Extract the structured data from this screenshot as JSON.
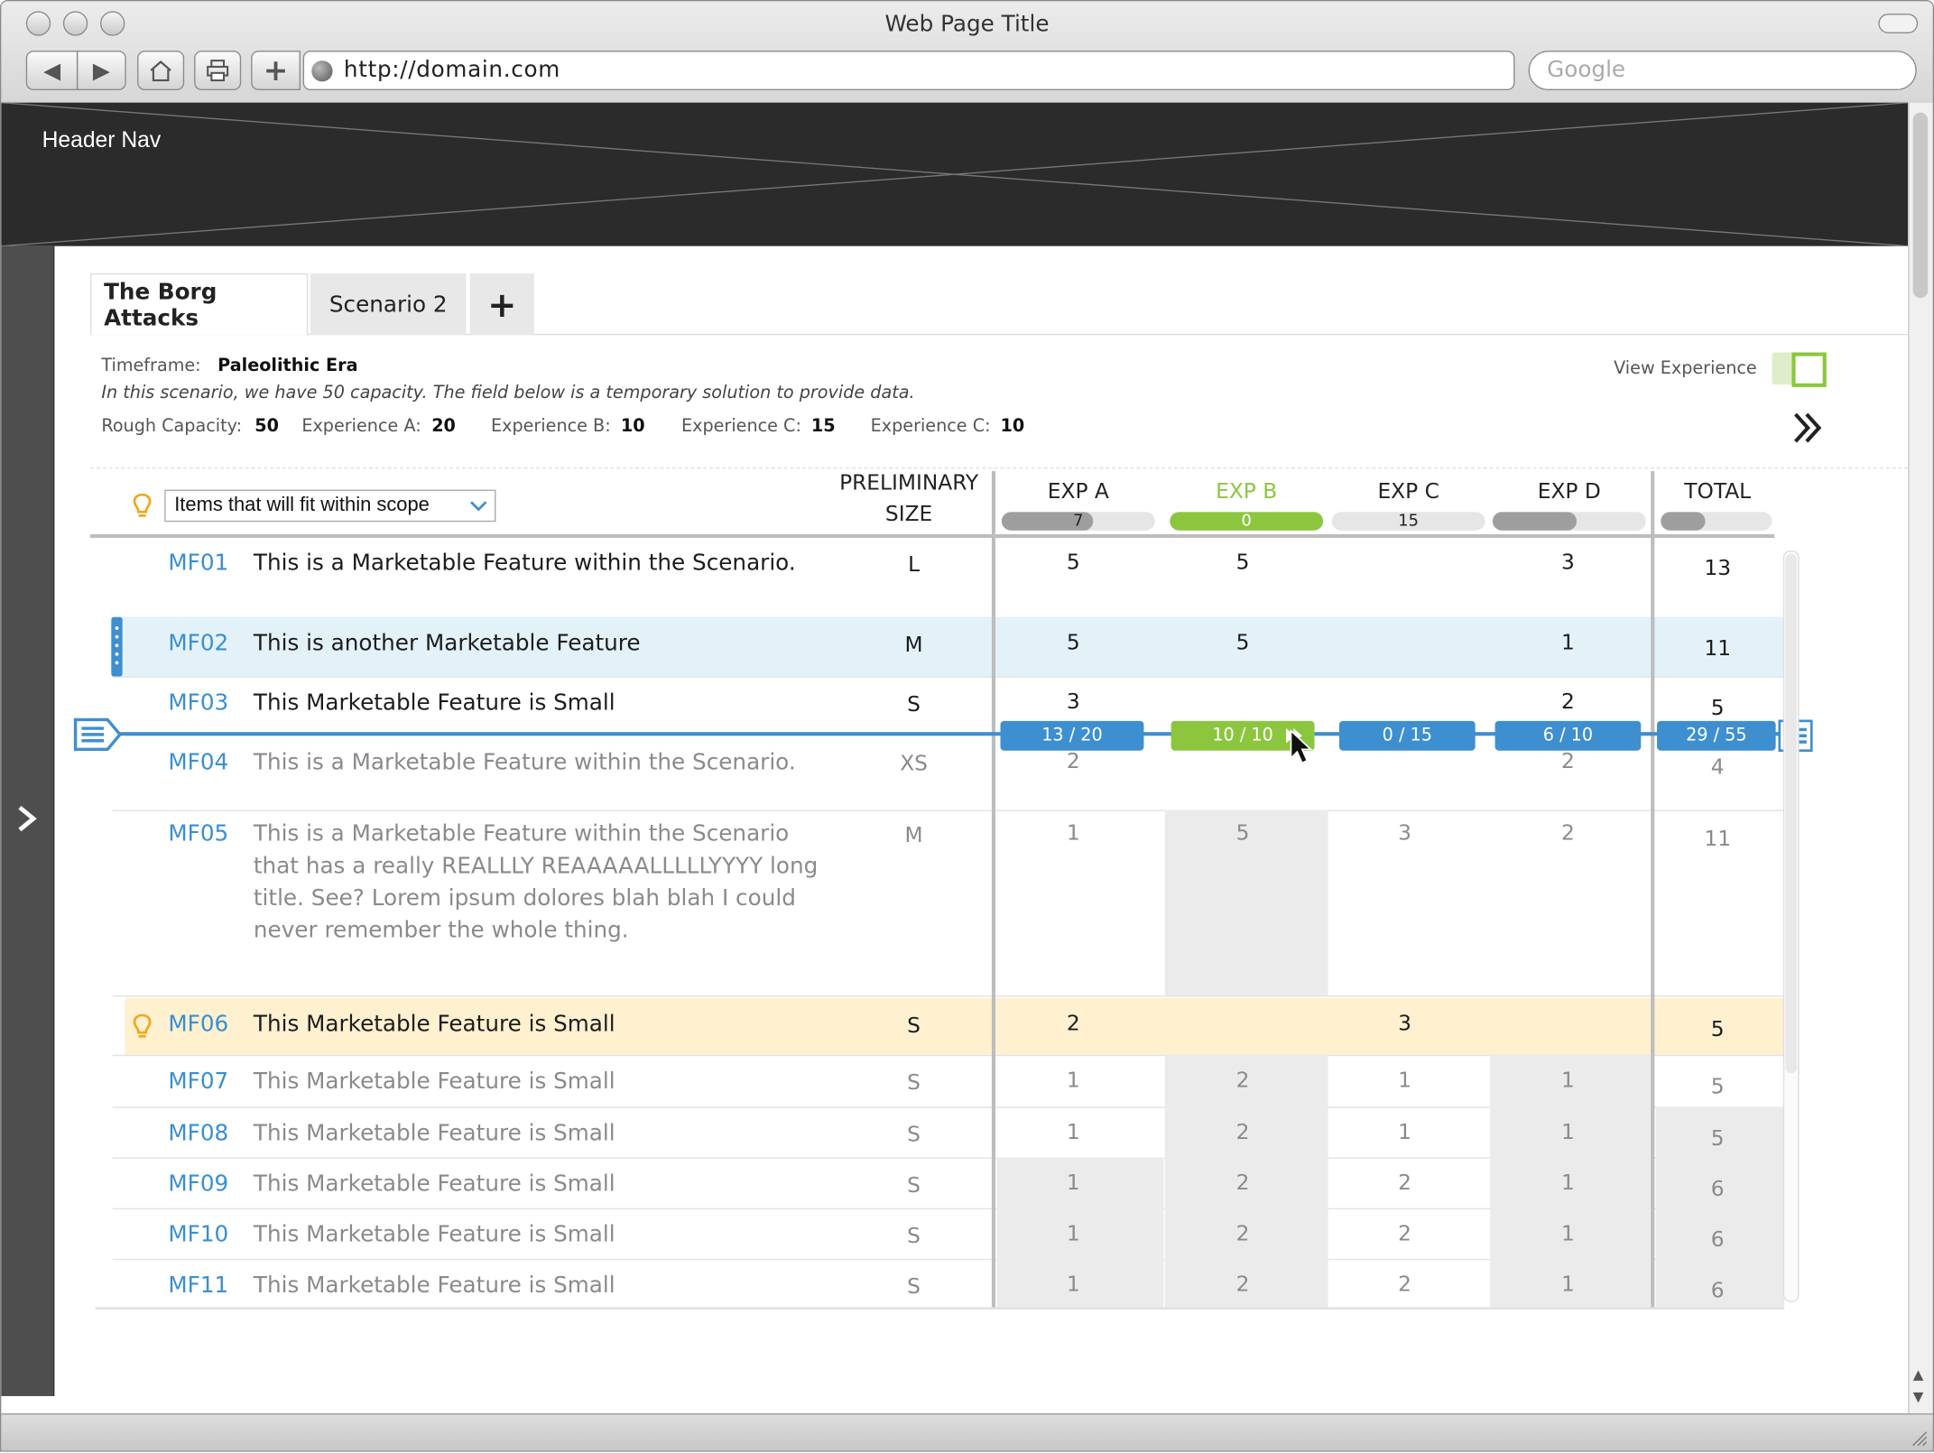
{
  "browser": {
    "window_title": "Web Page Title",
    "url": "http://domain.com",
    "search_placeholder": "Google"
  },
  "header": {
    "label": "Header Nav"
  },
  "tabs": [
    {
      "label": "The Borg Attacks",
      "active": true
    },
    {
      "label": "Scenario 2",
      "active": false
    }
  ],
  "add_tab_label": "+",
  "scenario": {
    "timeframe_label": "Timeframe:",
    "timeframe_value": "Paleolithic Era",
    "note": "In this scenario, we have 50 capacity. The field below is a temporary solution to provide data.",
    "capacities": [
      {
        "label": "Rough Capacity:",
        "value": "50"
      },
      {
        "label": "Experience A:",
        "value": "20"
      },
      {
        "label": "Experience B:",
        "value": "10"
      },
      {
        "label": "Experience C:",
        "value": "15"
      },
      {
        "label": "Experience C:",
        "value": "10"
      }
    ],
    "view_experience_label": "View Experience"
  },
  "filter": {
    "selected": "Items that will fit within scope"
  },
  "columns": {
    "size_line1": "PRELIMINARY",
    "size_line2": "SIZE",
    "exp": [
      {
        "label": "EXP A",
        "used": "7",
        "fill": 0.6,
        "color": "#222222"
      },
      {
        "label": "EXP B",
        "used": "0",
        "fill": 1.0,
        "color": "#8cc63f"
      },
      {
        "label": "EXP C",
        "used": "15",
        "fill": 0.0,
        "color": "#222222"
      },
      {
        "label": "EXP D",
        "used": "",
        "fill": 0.55,
        "color": "#222222"
      }
    ],
    "total": {
      "label": "TOTAL",
      "used": "",
      "fill": 0.4
    }
  },
  "rows": [
    {
      "id": "MF01",
      "title": [
        "This is a Marketable Feature within the Scenario."
      ],
      "size": "L",
      "a": "5",
      "b": "5",
      "c": "",
      "d": "3",
      "total": "13",
      "style": "normal"
    },
    {
      "id": "MF02",
      "title": [
        "This is another Marketable Feature"
      ],
      "size": "M",
      "a": "5",
      "b": "5",
      "c": "",
      "d": "1",
      "total": "11",
      "style": "selected"
    },
    {
      "id": "MF03",
      "title": [
        "This Marketable Feature is Small"
      ],
      "size": "S",
      "a": "3",
      "b": "",
      "c": "",
      "d": "2",
      "total": "5",
      "style": "normal"
    },
    {
      "id": "MF04",
      "title": [
        "This is a Marketable Feature within the Scenario."
      ],
      "size": "XS",
      "a": "2",
      "b": "",
      "c": "",
      "d": "2",
      "total": "4",
      "style": "muted"
    },
    {
      "id": "MF05",
      "title": [
        "This is a Marketable Feature within the Scenario",
        "that has a really REALLLY REAAAAALLLLLYYYY long",
        "title. See? Lorem ipsum dolores blah blah I could",
        "never remember the whole thing."
      ],
      "size": "M",
      "a": "1",
      "b": "5",
      "c": "3",
      "d": "2",
      "total": "11",
      "style": "muted"
    },
    {
      "id": "MF06",
      "title": [
        "This Marketable Feature is Small"
      ],
      "size": "S",
      "a": "2",
      "b": "",
      "c": "3",
      "d": "",
      "total": "5",
      "style": "highlight"
    },
    {
      "id": "MF07",
      "title": [
        "This Marketable Feature is Small"
      ],
      "size": "S",
      "a": "1",
      "b": "2",
      "c": "1",
      "d": "1",
      "total": "5",
      "style": "muted"
    },
    {
      "id": "MF08",
      "title": [
        "This Marketable Feature is Small"
      ],
      "size": "S",
      "a": "1",
      "b": "2",
      "c": "1",
      "d": "1",
      "total": "5",
      "style": "muted"
    },
    {
      "id": "MF09",
      "title": [
        "This Marketable Feature is Small"
      ],
      "size": "S",
      "a": "1",
      "b": "2",
      "c": "2",
      "d": "1",
      "total": "6",
      "style": "muted"
    },
    {
      "id": "MF10",
      "title": [
        "This Marketable Feature is Small"
      ],
      "size": "S",
      "a": "1",
      "b": "2",
      "c": "2",
      "d": "1",
      "total": "6",
      "style": "muted"
    },
    {
      "id": "MF11",
      "title": [
        "This Marketable Feature is Small"
      ],
      "size": "S",
      "a": "1",
      "b": "2",
      "c": "2",
      "d": "1",
      "total": "6",
      "style": "muted"
    }
  ],
  "capacity_line": {
    "a": "13  /  20",
    "b": "10  /  10",
    "c": "0  /  15",
    "d": "6  /  10",
    "total": "29  /  55",
    "b_color": "#8cc63f"
  },
  "colors": {
    "accent_blue": "#3e8fd0",
    "green": "#8cc63f",
    "selected_row": "#e3f2f9",
    "highlight_row": "#fff0d0",
    "bulb": "#f0a81c"
  }
}
